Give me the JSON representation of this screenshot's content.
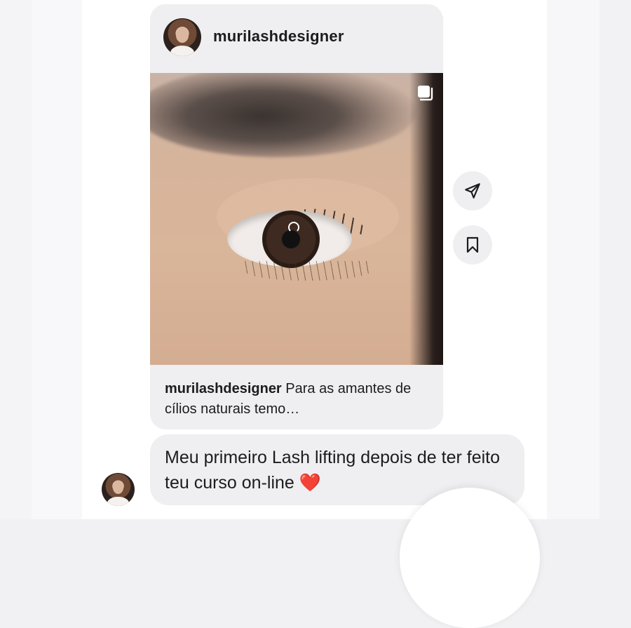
{
  "post": {
    "username": "murilashdesigner",
    "caption_user": "murilashdesigner",
    "caption_text": "Para as amantes de cílios naturais temo…"
  },
  "message": {
    "text": "Meu primeiro Lash lifting depois de ter feito teu curso on-line",
    "emoji": "❤️"
  },
  "icons": {
    "share": "paper-plane-icon",
    "save": "bookmark-icon",
    "carousel": "multiple-images-icon"
  },
  "colors": {
    "bubble": "#efeff1",
    "heart": "#e0243a",
    "text": "#1c1c1e"
  }
}
